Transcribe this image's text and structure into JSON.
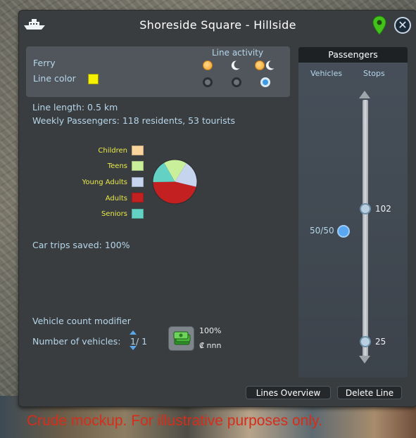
{
  "window": {
    "title": "Shoreside Square - Hillside",
    "close_glyph": "✕"
  },
  "icons": {
    "transport_type": "ferry-icon",
    "location": "location-pin-icon",
    "money": "money-icon"
  },
  "info": {
    "line_type": "Ferry",
    "line_color_label": "Line color",
    "line_color": "#f4f000",
    "line_activity_label": "Line activity",
    "activity_options": [
      {
        "name": "day",
        "selected": false
      },
      {
        "name": "night",
        "selected": false
      },
      {
        "name": "day-and-night",
        "selected": true
      }
    ]
  },
  "stats": {
    "line_length": "Line length: 0.5 km",
    "weekly_passengers": "Weekly Passengers: 118 residents, 53 tourists",
    "car_trips_saved": "Car trips saved: 100%"
  },
  "chart_data": {
    "type": "pie",
    "categories": [
      "Children",
      "Teens",
      "Young Adults",
      "Adults",
      "Seniors"
    ],
    "values": [
      0,
      17,
      20,
      46,
      17
    ],
    "colors": [
      "#f9d49d",
      "#c9ef9a",
      "#c6d4ee",
      "#c32121",
      "#63d2c5"
    ]
  },
  "vehicles": {
    "modifier_label": "Vehicle count modifier",
    "count_label": "Number of vehicles:",
    "count_value": "1/ 1",
    "budget_percent": "100%",
    "cost": "₡ nnn"
  },
  "passengers_panel": {
    "title": "Passengers",
    "col_vehicles": "Vehicles",
    "col_stops": "Stops",
    "vehicle_marker": "50/50",
    "stop_values": [
      "102",
      "25"
    ]
  },
  "buttons": {
    "lines_overview": "Lines Overview",
    "delete_line": "Delete Line"
  },
  "disclaimer": "Crude mockup. For illustrative purposes only."
}
